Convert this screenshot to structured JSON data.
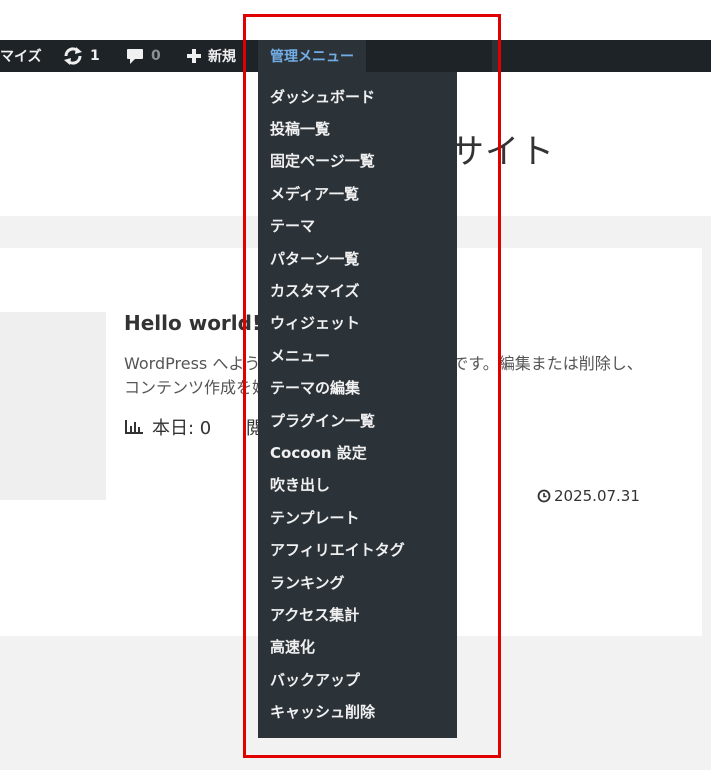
{
  "adminbar": {
    "customize_label": "マイズ",
    "updates_count": "1",
    "comments_count": "0",
    "new_label": "新規",
    "admin_menu_label": "管理メニュー"
  },
  "site": {
    "title_partial": "サイト"
  },
  "post": {
    "title": "Hello world!",
    "excerpt": "WordPress へようこそ。こちらは最初の投稿です。編集または削除し、コンテンツ作成を始めてください。",
    "stats_today": "本日: 0",
    "stats_extra": "閲",
    "date": "2025.07.31"
  },
  "dropdown": {
    "items": [
      "ダッシュボード",
      "投稿一覧",
      "固定ページ一覧",
      "メディア一覧",
      "テーマ",
      "パターン一覧",
      "カスタマイズ",
      "ウィジェット",
      "メニュー",
      "テーマの編集",
      "プラグイン一覧",
      "Cocoon 設定",
      "吹き出し",
      "テンプレート",
      "アフィリエイトタグ",
      "ランキング",
      "アクセス集計",
      "高速化",
      "バックアップ",
      "キャッシュ削除"
    ]
  },
  "colors": {
    "adminbar_bg": "#1d2327",
    "menu_bg": "#2c3338",
    "menu_active_text": "#72aee6",
    "outline": "#e00000"
  }
}
